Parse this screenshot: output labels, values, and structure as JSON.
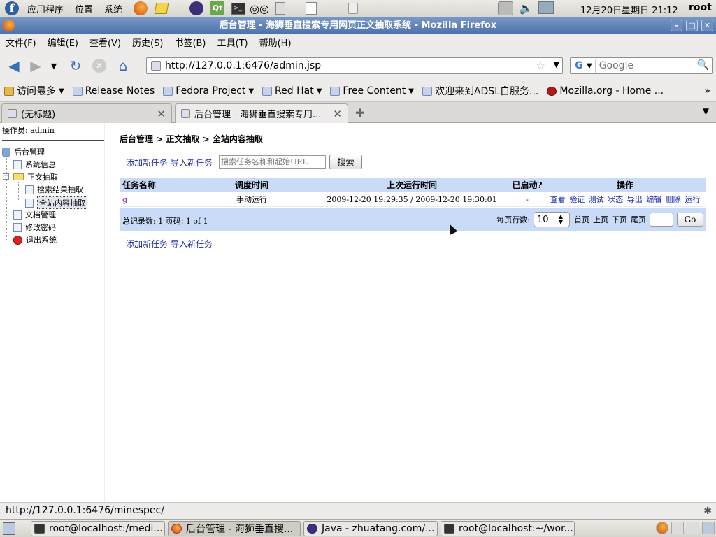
{
  "desktop": {
    "menus": [
      "应用程序",
      "位置",
      "系统"
    ],
    "clock": "12月20日星期日 21:12",
    "user": "root"
  },
  "window": {
    "title": "后台管理 - 海狮垂直搜索专用网页正文抽取系统 - Mozilla Firefox"
  },
  "menubar": [
    "文件(F)",
    "编辑(E)",
    "查看(V)",
    "历史(S)",
    "书签(B)",
    "工具(T)",
    "帮助(H)"
  ],
  "nav": {
    "url": "http://127.0.0.1:6476/admin.jsp",
    "search_placeholder": "Google"
  },
  "bookmarks": [
    {
      "label": "访问最多",
      "folder": true
    },
    {
      "label": "Release Notes",
      "folder": false
    },
    {
      "label": "Fedora Project",
      "folder": true
    },
    {
      "label": "Red Hat",
      "folder": true
    },
    {
      "label": "Free Content",
      "folder": true
    },
    {
      "label": "欢迎来到ADSL自服务...",
      "folder": false
    },
    {
      "label": "Mozilla.org - Home ...",
      "folder": false
    }
  ],
  "tabs": [
    {
      "label": "(无标题)",
      "active": false
    },
    {
      "label": "后台管理 - 海狮垂直搜索专用...",
      "active": true
    }
  ],
  "sidebar": {
    "operator": "操作员: admin",
    "tree": {
      "root": "后台管理",
      "sysinfo": "系统信息",
      "extract": "正文抽取",
      "search_extract": "搜索结果抽取",
      "site_extract": "全站内容抽取",
      "docs": "文档管理",
      "password": "修改密码",
      "logout": "退出系统"
    }
  },
  "main": {
    "breadcrumb": "后台管理 > 正文抽取 > 全站内容抽取",
    "add_task": "添加新任务",
    "import_task": "导入新任务",
    "search_placeholder": "搜索任务名称和起始URL",
    "search_button": "搜索",
    "table": {
      "headers": [
        "任务名称",
        "调度时间",
        "上次运行时间",
        "已启动?",
        "操作"
      ],
      "rows": [
        {
          "name": "g",
          "schedule": "手动运行",
          "last_run": "2009-12-20 19:29:35 / 2009-12-20 19:30:01",
          "started": "-",
          "ops": [
            "查看",
            "验证",
            "测试",
            "状态",
            "导出",
            "编辑",
            "删除",
            "运行"
          ]
        }
      ]
    },
    "footer": {
      "stats": "总记录数: 1 页码: 1 of 1",
      "per_page_label": "每页行数:",
      "per_page_value": "10",
      "first": "首页",
      "prev": "上页",
      "next": "下页",
      "last": "尾页",
      "go": "Go"
    }
  },
  "statusbar": {
    "text": "http://127.0.0.1:6476/minespec/"
  },
  "taskbar": [
    "root@localhost:/medi...",
    "后台管理 - 海狮垂直搜...",
    "Java - zhuatang.com/...",
    "root@localhost:~/wor..."
  ]
}
